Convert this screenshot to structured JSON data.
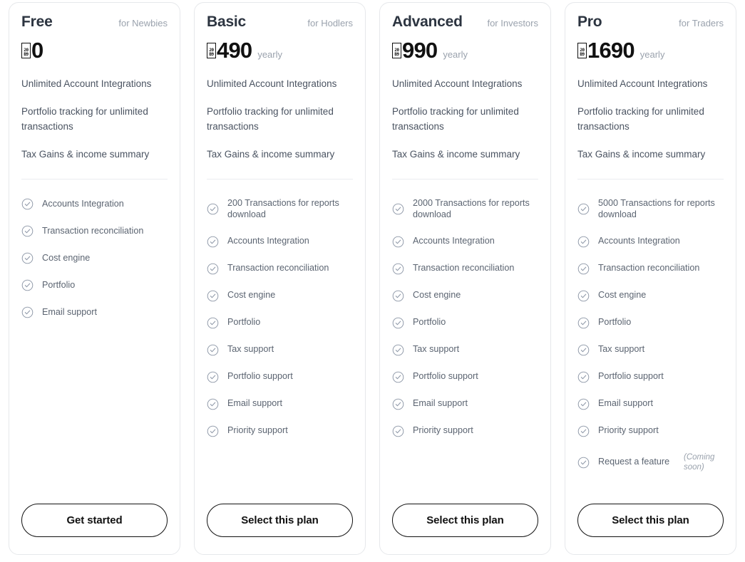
{
  "currency": {
    "glyph_missing": true,
    "codepoint_hi": "20",
    "codepoint_lo": "B9",
    "symbol_name": "indian-rupee-sign"
  },
  "plans": [
    {
      "name": "Free",
      "audience": "for Newbies",
      "price": "0",
      "period": "",
      "highlights": [
        "Unlimited Account Integrations",
        "Portfolio tracking for unlimited transactions",
        "Tax Gains & income summary"
      ],
      "features": [
        {
          "label": "Accounts Integration",
          "note": ""
        },
        {
          "label": "Transaction reconciliation",
          "note": ""
        },
        {
          "label": "Cost engine",
          "note": ""
        },
        {
          "label": "Portfolio",
          "note": ""
        },
        {
          "label": "Email support",
          "note": ""
        }
      ],
      "cta": "Get started"
    },
    {
      "name": "Basic",
      "audience": "for Hodlers",
      "price": "490",
      "period": "yearly",
      "highlights": [
        "Unlimited Account Integrations",
        "Portfolio tracking for unlimited transactions",
        "Tax Gains & income summary"
      ],
      "features": [
        {
          "label": "200 Transactions for reports download",
          "note": ""
        },
        {
          "label": "Accounts Integration",
          "note": ""
        },
        {
          "label": "Transaction reconciliation",
          "note": ""
        },
        {
          "label": "Cost engine",
          "note": ""
        },
        {
          "label": "Portfolio",
          "note": ""
        },
        {
          "label": "Tax support",
          "note": ""
        },
        {
          "label": "Portfolio support",
          "note": ""
        },
        {
          "label": "Email support",
          "note": ""
        },
        {
          "label": "Priority support",
          "note": ""
        }
      ],
      "cta": "Select this plan"
    },
    {
      "name": "Advanced",
      "audience": "for Investors",
      "price": "990",
      "period": "yearly",
      "highlights": [
        "Unlimited Account Integrations",
        "Portfolio tracking for unlimited transactions",
        "Tax Gains & income summary"
      ],
      "features": [
        {
          "label": "2000 Transactions for reports download",
          "note": ""
        },
        {
          "label": "Accounts Integration",
          "note": ""
        },
        {
          "label": "Transaction reconciliation",
          "note": ""
        },
        {
          "label": "Cost engine",
          "note": ""
        },
        {
          "label": "Portfolio",
          "note": ""
        },
        {
          "label": "Tax support",
          "note": ""
        },
        {
          "label": "Portfolio support",
          "note": ""
        },
        {
          "label": "Email support",
          "note": ""
        },
        {
          "label": "Priority support",
          "note": ""
        }
      ],
      "cta": "Select this plan"
    },
    {
      "name": "Pro",
      "audience": "for Traders",
      "price": "1690",
      "period": "yearly",
      "highlights": [
        "Unlimited Account Integrations",
        "Portfolio tracking for unlimited transactions",
        "Tax Gains & income summary"
      ],
      "features": [
        {
          "label": "5000 Transactions for reports download",
          "note": ""
        },
        {
          "label": "Accounts Integration",
          "note": ""
        },
        {
          "label": "Transaction reconciliation",
          "note": ""
        },
        {
          "label": "Cost engine",
          "note": ""
        },
        {
          "label": "Portfolio",
          "note": ""
        },
        {
          "label": "Tax support",
          "note": ""
        },
        {
          "label": "Portfolio support",
          "note": ""
        },
        {
          "label": "Email support",
          "note": ""
        },
        {
          "label": "Priority support",
          "note": ""
        },
        {
          "label": "Request a feature",
          "note": "(Coming soon)"
        }
      ],
      "cta": "Select this plan"
    }
  ],
  "colors": {
    "card_border": "#e6e8eb",
    "divider": "#ebedf0",
    "plan_name": "#2c3440",
    "muted": "#9aa2ad",
    "body_text": "#5b6471",
    "price": "#111111",
    "check_icon": "#8b95a5"
  }
}
